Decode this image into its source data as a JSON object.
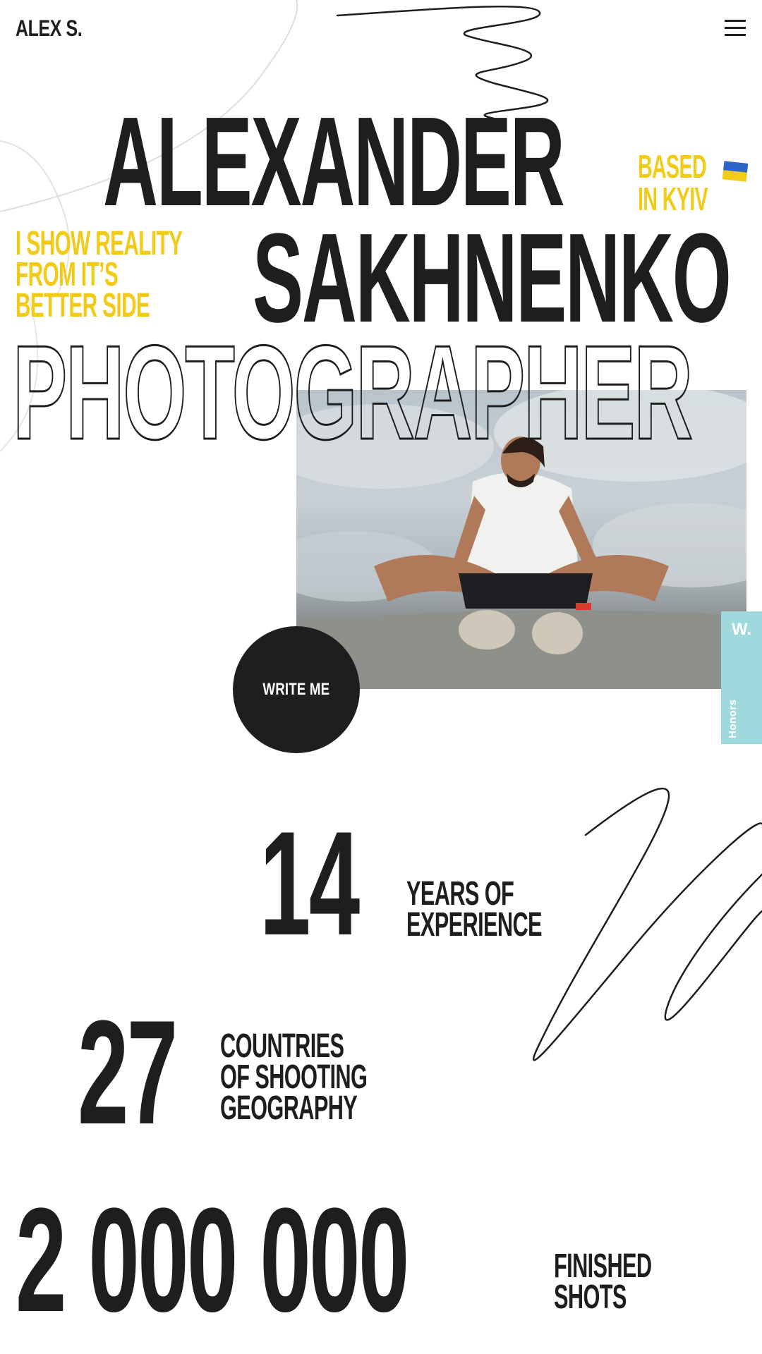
{
  "header": {
    "logo": "ALEX S.",
    "menu_icon": "hamburger-menu-icon"
  },
  "hero": {
    "first_name": "ALEXANDER",
    "last_name": "SAKHNENKO",
    "role": "PHOTOGRAPHER",
    "based_line1": "BASED",
    "based_line2": "IN KYIV",
    "flag_icon": "ukraine-flag-icon",
    "tagline_line1": "I SHOW REALITY",
    "tagline_line2": "FROM IT’S",
    "tagline_line3": "BETTER SIDE",
    "cta": "WRITE ME"
  },
  "honors_badge": {
    "logo": "W.",
    "label": "Honors"
  },
  "stats": [
    {
      "value": "14",
      "line1": "YEARS OF",
      "line2": "EXPERIENCE"
    },
    {
      "value": "27",
      "line1": "COUNTRIES",
      "line2": "OF SHOOTING",
      "line3": "GEOGRAPHY"
    },
    {
      "value": "2 000 000",
      "line1": "FINISHED",
      "line2": "SHOTS"
    }
  ],
  "colors": {
    "text": "#1e1e1e",
    "accent_yellow": "#f2ca18",
    "badge_teal": "#9fd9dd",
    "flag_blue": "#2d66c8"
  }
}
